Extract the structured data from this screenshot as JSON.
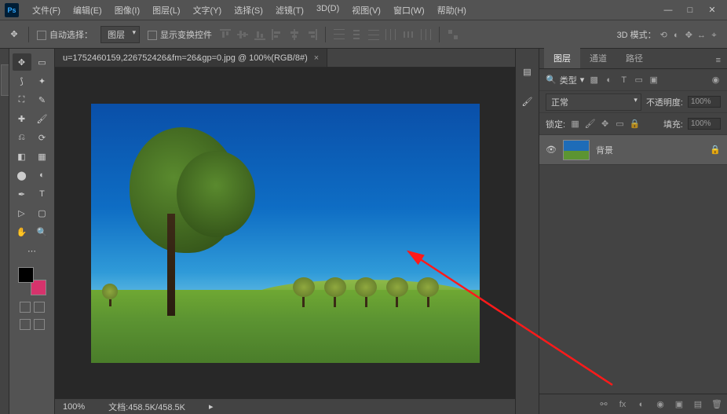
{
  "app": {
    "logo": "Ps"
  },
  "menu": [
    "文件(F)",
    "编辑(E)",
    "图像(I)",
    "图层(L)",
    "文字(Y)",
    "选择(S)",
    "滤镜(T)",
    "3D(D)",
    "视图(V)",
    "窗口(W)",
    "帮助(H)"
  ],
  "options": {
    "auto_select_label": "自动选择：",
    "layer_dd": "图层",
    "show_controls_label": "显示变换控件",
    "mode3d_label": "3D 模式："
  },
  "document": {
    "tab_title": "u=1752460159,226752426&fm=26&gp=0.jpg @ 100%(RGB/8#)",
    "zoom": "100%",
    "doc_size": "文档:458.5K/458.5K"
  },
  "panels": {
    "tabs": [
      "图层",
      "通道",
      "路径"
    ],
    "kind_label": "类型",
    "blend_mode": "正常",
    "opacity_label": "不透明度:",
    "opacity_value": "100%",
    "lock_label": "锁定:",
    "fill_label": "填充:",
    "fill_value": "100%",
    "layer_name": "背景"
  }
}
